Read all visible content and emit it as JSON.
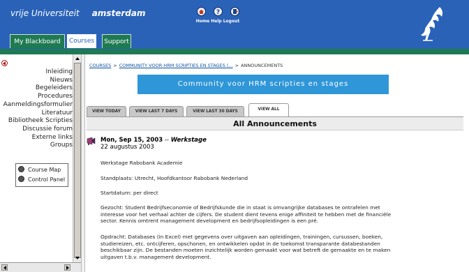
{
  "header": {
    "brand_left": "vrije Universiteit",
    "brand_right": "amsterdam",
    "top_links": [
      "Home",
      "Help",
      "Logout"
    ]
  },
  "tabs": [
    "My Blackboard",
    "Courses",
    "Support"
  ],
  "active_tab": "Courses",
  "left_menu": {
    "items": [
      "Inleiding",
      "Nieuws",
      "Begeleiders",
      "Procedures",
      "Aanmeldingsformulier",
      "Literatuur",
      "Bibliotheek Scripties",
      "Discussie forum",
      "Externe links",
      "Groups"
    ],
    "tools": [
      "Course Map",
      "Control Panel"
    ]
  },
  "breadcrumb": {
    "courses": "COURSES",
    "community": "COMMUNITY VOOR HRM SCRIPTIES EN STAGES (...",
    "current": "ANNOUNCEMENTS"
  },
  "banner": "Community voor HRM scripties en stages",
  "view_tabs": [
    "VIEW TODAY",
    "VIEW LAST 7 DAYS",
    "VIEW LAST 30 DAYS",
    "VIEW ALL"
  ],
  "active_view_tab": "VIEW ALL",
  "section_title": "All Announcements",
  "announcement": {
    "date": "Mon, Sep 15, 2003",
    "dash": "--",
    "title": "Werkstage",
    "subtitle": "22 augustus 2003",
    "paragraphs": [
      [
        "Werkstage Rabobank Academie"
      ],
      [
        "Standplaats: Utrecht, Hoofdkantoor Rabobank Nederland"
      ],
      [
        "Startdatum: per direct"
      ],
      [
        "Gezocht: Student Bedrijfseconomie of Bedrijfskunde die in staat is omvangrijke databases te ontrafelen met",
        "interesse voor het verhaal achter de cijfers. De student dient tevens enige affiniteit te hebben met de financiële",
        "sector. Kennis omtrent management development en bedrijfsopleidingen is een pré."
      ],
      [
        "Opdracht: Databases (in Excel) met gegevens over uitgaven aan opleidingen, trainingen, cursussen, boeken,",
        "studiereizen, etc. ontcijferen, opschonen, en ontwikkelen opdat in de toekomst transparante databestanden",
        "beschikbaar zijn. De bestanden moeten inzichtelijk worden gemaakt voor wat betreft de gemaakte en te maken",
        "uitgaven t.b.v. management development."
      ]
    ]
  },
  "colors": {
    "header_blue": "#2a62b8",
    "tab_green": "#1e7a52",
    "banner_blue": "#2f96d8",
    "collapse_red": "#b01010"
  },
  "icons": {
    "home": "home-icon",
    "help": "help-icon",
    "logout": "logout-icon",
    "logo": "vu-griffin-logo",
    "announcement": "megaphone-icon",
    "course_map": "course-map-icon",
    "control_panel": "control-panel-icon",
    "collapse": "collapse-arrow-icon"
  }
}
